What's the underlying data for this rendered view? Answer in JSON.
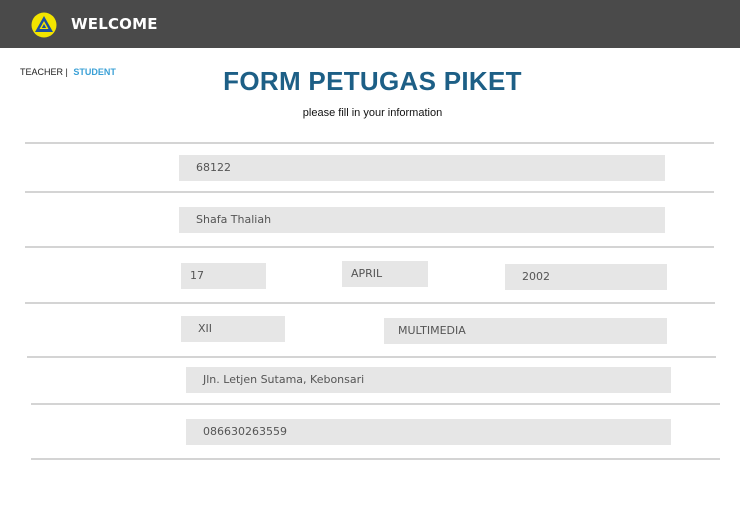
{
  "header": {
    "title": "WELCOME",
    "logo_icon": "triangle-logo-icon",
    "bar_color": "#4a4a4a"
  },
  "roles": {
    "teacher": "TEACHER",
    "separator": "|",
    "student": "STUDENT",
    "active_color": "#3aa0d6"
  },
  "form": {
    "title": "FORM PETUGAS PIKET",
    "subtitle": "please fill in your information",
    "title_color": "#1d5f86",
    "fields": {
      "id_number": "68122",
      "name": "Shafa Thaliah",
      "birth_day": "17",
      "birth_month": "APRIL",
      "birth_year": "2002",
      "class_level": "XII",
      "major": "MULTIMEDIA",
      "address": "Jln. Letjen Sutama, Kebonsari",
      "phone": "086630263559"
    }
  }
}
